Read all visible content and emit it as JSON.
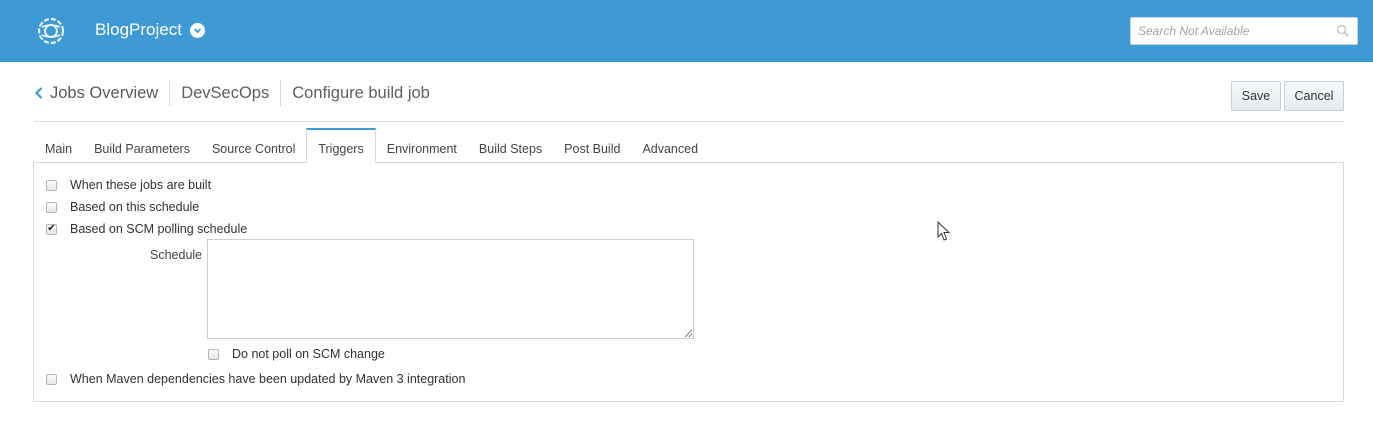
{
  "header": {
    "project_name": "BlogProject",
    "search_placeholder": "Search Not Available",
    "icons": {
      "logo": "project-logo-icon",
      "project_menu": "chevron-down-circle-icon",
      "search": "search-icon"
    },
    "colors": {
      "bar": "#3d9ad5"
    }
  },
  "breadcrumb": {
    "back_label": "Jobs Overview",
    "items": [
      "DevSecOps",
      "Configure build job"
    ]
  },
  "actions": {
    "save": "Save",
    "cancel": "Cancel"
  },
  "tabs": [
    {
      "label": "Main",
      "active": false
    },
    {
      "label": "Build Parameters",
      "active": false
    },
    {
      "label": "Source Control",
      "active": false
    },
    {
      "label": "Triggers",
      "active": true
    },
    {
      "label": "Environment",
      "active": false
    },
    {
      "label": "Build Steps",
      "active": false
    },
    {
      "label": "Post Build",
      "active": false
    },
    {
      "label": "Advanced",
      "active": false
    }
  ],
  "triggers": {
    "jobs_built": {
      "label": "When these jobs are built",
      "checked": false
    },
    "schedule": {
      "label": "Based on this schedule",
      "checked": false
    },
    "scm_polling": {
      "label": "Based on SCM polling schedule",
      "checked": true
    },
    "schedule_field": {
      "label": "Schedule",
      "value": ""
    },
    "no_poll": {
      "label": "Do not poll on SCM change",
      "checked": false
    },
    "maven": {
      "label": "When Maven dependencies have been updated by Maven 3 integration",
      "checked": false
    }
  }
}
